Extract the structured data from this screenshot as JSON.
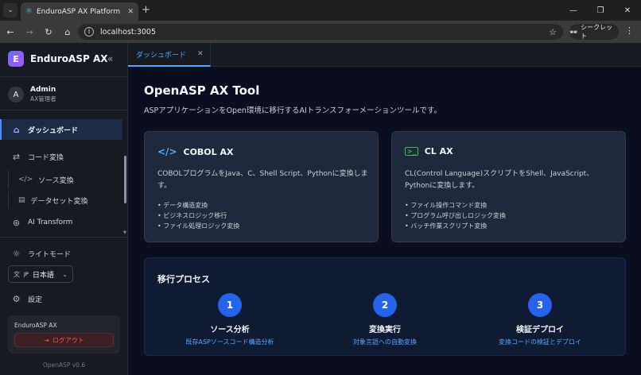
{
  "browser": {
    "tab_title": "EnduroASP AX Platform",
    "url": "localhost:3005",
    "profile_label": "シークレット"
  },
  "sidebar": {
    "brand_letter": "E",
    "brand_name": "EnduroASP AX",
    "user": {
      "initial": "A",
      "name": "Admin",
      "role": "AX管理者"
    },
    "nav": {
      "dashboard": "ダッシュボード",
      "code_conversion": "コード変換",
      "source_conversion": "ソース変換",
      "dataset_conversion": "データセット変換",
      "ai_transform": "AI Transform"
    },
    "light_mode": "ライトモード",
    "language": {
      "prefix": "JP",
      "value": "日本語"
    },
    "settings": "設定",
    "footer_label": "EnduroASP AX",
    "logout": "ログアウト",
    "version": "OpenASP v0.6"
  },
  "main": {
    "tab_label": "ダッシュボード",
    "title": "OpenASP AX Tool",
    "description": "ASPアプリケーションをOpen環境に移行するAIトランスフォーメーションツールです。",
    "cards": [
      {
        "icon": "code-icon",
        "title": "COBOL AX",
        "description": "COBOLプログラムをJava、C、Shell Script、Pythonに変換します。",
        "items": [
          "• データ構造変換",
          "• ビジネスロジック移行",
          "• ファイル処理ロジック変換"
        ]
      },
      {
        "icon": "terminal-icon",
        "title": "CL AX",
        "description": "CL(Control Language)スクリプトをShell、JavaScript、Pythonに変換します。",
        "items": [
          "• ファイル操作コマンド変換",
          "• プログラム呼び出しロジック変換",
          "• バッチ作業スクリプト変換"
        ]
      }
    ],
    "process": {
      "title": "移行プロセス",
      "steps": [
        {
          "num": "1",
          "title": "ソース分析",
          "desc": "既存ASPソースコード構造分析"
        },
        {
          "num": "2",
          "title": "変換実行",
          "desc": "対象言語への自動変換"
        },
        {
          "num": "3",
          "title": "検証デプロイ",
          "desc": "変換コードの検証とデプロイ"
        }
      ]
    }
  },
  "colors": {
    "accent": "#58a6ff",
    "step_circle": "#2563eb",
    "cobol_icon": "#58a6ff",
    "cl_icon": "#3fb950",
    "logout": "#f85149"
  }
}
